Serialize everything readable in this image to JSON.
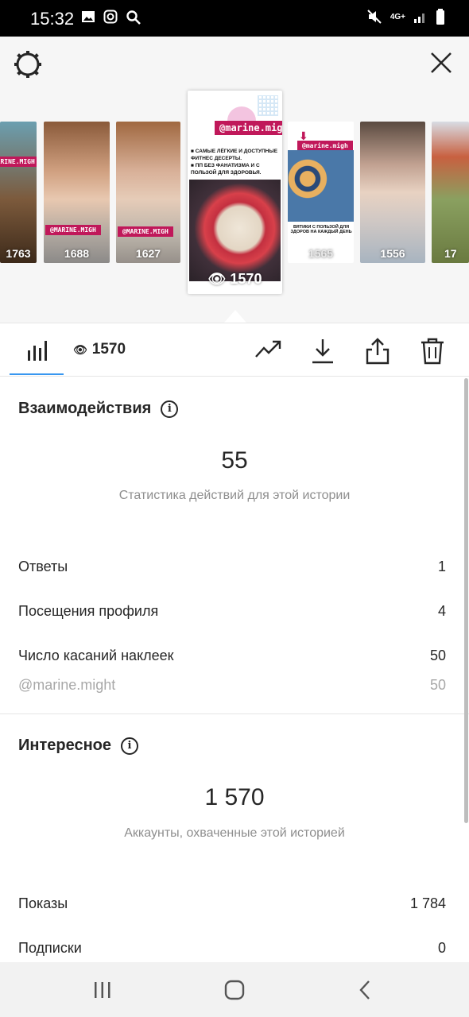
{
  "status_bar": {
    "time": "15:32",
    "network": "4G+"
  },
  "story_strip": {
    "thumbnails": [
      {
        "views": "1763",
        "tag": "@MARINE.MIGH"
      },
      {
        "views": "1688",
        "tag": "@MARINE.MIGH"
      },
      {
        "views": "1627",
        "tag": "@MARINE.MIGH"
      },
      {
        "views": "1570",
        "tag": "@marine.migh",
        "selected": true,
        "lines": [
          "■ САМЫЕ ЛЁГКИЕ И ДОСТУПНЫЕ ФИТНЕС ДЕСЕРТЫ.",
          "■ ПП БЕЗ ФАНАТИЗМА И С ПОЛЬЗОЙ ДЛЯ ЗДОРОВЬЯ."
        ]
      },
      {
        "views": "1565",
        "tag": "@marine.migh",
        "caption": "ВЯТИКИ С ПОЛЬЗОЙ ДЛЯ ЗДОРОВ НА КАЖДЫЙ ДЕНЬ"
      },
      {
        "views": "1556"
      },
      {
        "views": "17"
      }
    ]
  },
  "toolbar": {
    "views": "1570"
  },
  "interactions": {
    "title": "Взаимодействия",
    "total": "55",
    "caption": "Статистика действий для этой истории",
    "rows": [
      {
        "label": "Ответы",
        "value": "1"
      },
      {
        "label": "Посещения профиля",
        "value": "4"
      },
      {
        "label": "Число касаний наклеек",
        "value": "50"
      },
      {
        "label": "@marine.might",
        "value": "50"
      }
    ]
  },
  "discovery": {
    "title": "Интересное",
    "total": "1 570",
    "caption": "Аккаунты, охваченные этой историей",
    "rows": [
      {
        "label": "Показы",
        "value": "1 784"
      },
      {
        "label": "Подписки",
        "value": "0"
      }
    ]
  }
}
